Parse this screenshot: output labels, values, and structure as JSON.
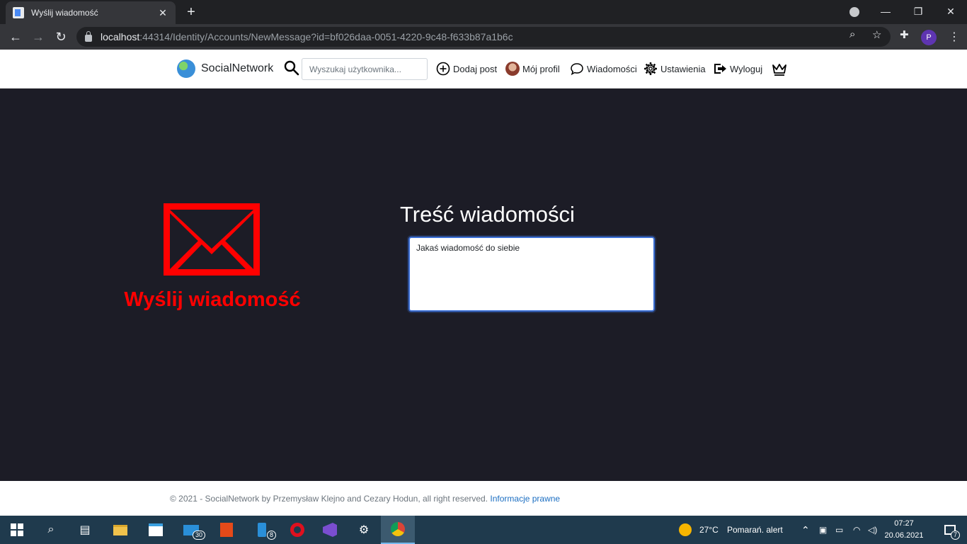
{
  "browser": {
    "tab_title": "Wyślij wiadomość",
    "tab_close": "✕",
    "new_tab": "+",
    "url_host": "localhost",
    "url_rest": ":44314/Identity/Accounts/NewMessage?id=bf026daa-0051-4220-9c48-f633b87a1b6c",
    "profile_initial": "P"
  },
  "navbar": {
    "brand": "SocialNetwork",
    "search_placeholder": "Wyszukaj użytkownika...",
    "links": {
      "add_post": "Dodaj post",
      "my_profile": "Mój profil",
      "messages": "Wiadomości",
      "settings": "Ustawienia",
      "logout": "Wyloguj"
    }
  },
  "main": {
    "send_title": "Wyślij wiadomość",
    "content_label": "Treść wiadomości",
    "message_value": "Jakaś wiadomość do siebie",
    "accent_color": "#ff0000"
  },
  "footer": {
    "text": "© 2021 - SocialNetwork by Przemysław Klejno and Cezary Hodun, all right reserved.",
    "link": "Informacje prawne"
  },
  "taskbar": {
    "mail_badge": "30",
    "phone_badge": "8",
    "weather_temp": "27°C",
    "weather_alert": "Pomarań. alert",
    "time": "07:27",
    "date": "20.06.2021",
    "notifications": "7"
  }
}
